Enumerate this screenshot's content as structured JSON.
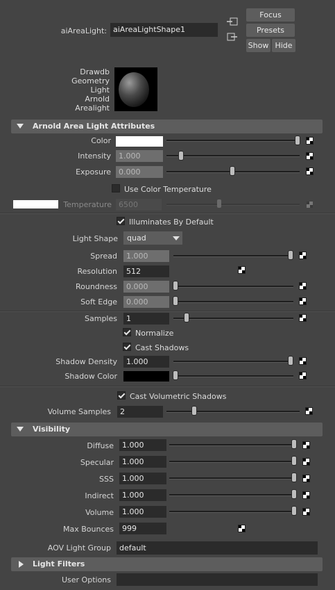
{
  "header": {
    "node_label": "aiAreaLight:",
    "node_value": "aiAreaLightShape1",
    "focus_label": "Focus",
    "presets_label": "Presets",
    "show_label": "Show",
    "hide_label": "Hide"
  },
  "swatch_text": [
    "Drawdb",
    "Geometry",
    "Light",
    "Arnold",
    "Arealight"
  ],
  "sections": {
    "area_light": "Arnold Area Light Attributes",
    "visibility": "Visibility",
    "light_filters": "Light Filters"
  },
  "attrs": {
    "color": {
      "label": "Color"
    },
    "intensity": {
      "label": "Intensity",
      "value": "1.000"
    },
    "exposure": {
      "label": "Exposure",
      "value": "0.000"
    },
    "use_color_temp": {
      "label": "Use Color Temperature",
      "checked": false
    },
    "temperature": {
      "label": "Temperature",
      "value": "6500"
    },
    "illuminates": {
      "label": "Illuminates By Default",
      "checked": true
    },
    "light_shape": {
      "label": "Light Shape",
      "value": "quad"
    },
    "spread": {
      "label": "Spread",
      "value": "1.000"
    },
    "resolution": {
      "label": "Resolution",
      "value": "512"
    },
    "roundness": {
      "label": "Roundness",
      "value": "0.000"
    },
    "soft_edge": {
      "label": "Soft Edge",
      "value": "0.000"
    },
    "samples": {
      "label": "Samples",
      "value": "1"
    },
    "normalize": {
      "label": "Normalize",
      "checked": true
    },
    "cast_shadows": {
      "label": "Cast Shadows",
      "checked": true
    },
    "shadow_density": {
      "label": "Shadow Density",
      "value": "1.000"
    },
    "shadow_color": {
      "label": "Shadow Color"
    },
    "cast_volumetric": {
      "label": "Cast Volumetric Shadows",
      "checked": true
    },
    "volume_samples": {
      "label": "Volume Samples",
      "value": "2"
    }
  },
  "visibility": {
    "diffuse": {
      "label": "Diffuse",
      "value": "1.000"
    },
    "specular": {
      "label": "Specular",
      "value": "1.000"
    },
    "sss": {
      "label": "SSS",
      "value": "1.000"
    },
    "indirect": {
      "label": "Indirect",
      "value": "1.000"
    },
    "volume": {
      "label": "Volume",
      "value": "1.000"
    },
    "max_bounces": {
      "label": "Max Bounces",
      "value": "999"
    },
    "aov_group": {
      "label": "AOV Light Group",
      "value": "default"
    }
  },
  "user_options": {
    "label": "User Options",
    "value": ""
  },
  "colors": {
    "panel_bg": "#444444",
    "field_bg": "#2b2b2b",
    "section_bg": "#5d5d5d",
    "light_color": "#ffffff",
    "shadow_color": "#000000"
  }
}
